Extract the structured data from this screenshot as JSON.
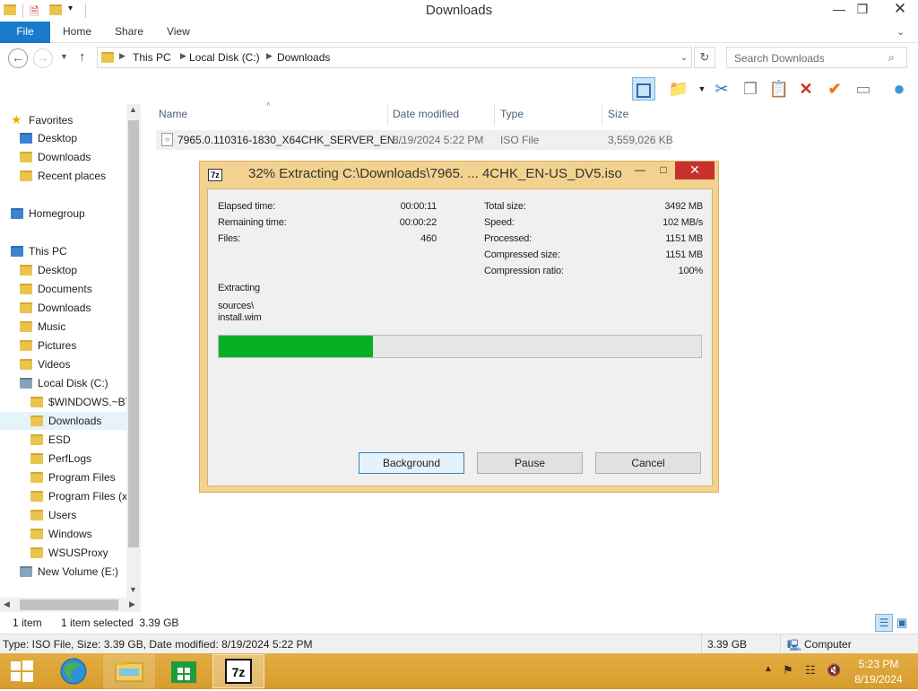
{
  "window": {
    "title": "Downloads",
    "controls": [
      "minimize",
      "restore",
      "close"
    ]
  },
  "ribbon": {
    "tabs": [
      "File",
      "Home",
      "Share",
      "View"
    ]
  },
  "address": {
    "crumbs": [
      "This PC",
      "Local Disk (C:)",
      "Downloads"
    ],
    "search_placeholder": "Search Downloads"
  },
  "nav": {
    "favorites_label": "Favorites",
    "favorites": [
      "Desktop",
      "Downloads",
      "Recent places"
    ],
    "homegroup": "Homegroup",
    "thispc_label": "This PC",
    "thispc": [
      "Desktop",
      "Documents",
      "Downloads",
      "Music",
      "Pictures",
      "Videos",
      "Local Disk (C:)"
    ],
    "localdisk": [
      "$WINDOWS.~BT",
      "Downloads",
      "ESD",
      "PerfLogs",
      "Program Files",
      "Program Files (x",
      "Users",
      "Windows",
      "WSUSProxy"
    ],
    "newvolume": "New Volume (E:)",
    "selected": "Downloads"
  },
  "files": {
    "headers": {
      "name": "Name",
      "date": "Date modified",
      "type": "Type",
      "size": "Size"
    },
    "rows": [
      {
        "name": "7965.0.110316-1830_X64CHK_SERVER_EN...",
        "date": "8/19/2024 5:22 PM",
        "type": "ISO File",
        "size": "3,559,026 KB"
      }
    ]
  },
  "status": {
    "count": "1 item",
    "selected": "1 item selected  3.39 GB",
    "info": "Type: ISO File, Size: 3.39 GB, Date modified: 8/19/2024 5:22 PM",
    "size": "3.39 GB",
    "location": "Computer"
  },
  "dialog": {
    "title": "32% Extracting C:\\Downloads\\7965. ... 4CHK_EN-US_DV5.iso",
    "icon_text": "7z",
    "left_stats": [
      {
        "label": "Elapsed time:",
        "value": "00:00:11"
      },
      {
        "label": "Remaining time:",
        "value": "00:00:22"
      },
      {
        "label": "Files:",
        "value": "460"
      }
    ],
    "right_stats": [
      {
        "label": "Total size:",
        "value": "3492 MB"
      },
      {
        "label": "Speed:",
        "value": "102 MB/s"
      },
      {
        "label": "Processed:",
        "value": "1151 MB"
      },
      {
        "label": "Compressed size:",
        "value": "1151 MB"
      },
      {
        "label": "Compression ratio:",
        "value": "100%"
      }
    ],
    "action": "Extracting",
    "path_line1": "sources\\",
    "path_line2": "install.wim",
    "progress": 0.32,
    "progress_color": "#06b025",
    "buttons": {
      "background": "Background",
      "pause": "Pause",
      "cancel": "Cancel"
    }
  },
  "taskbar": {
    "apps": [
      "start-button",
      "browser",
      "file-explorer",
      "store",
      "7zip"
    ],
    "active": "7zip",
    "time": "5:23 PM",
    "date": "8/19/2024",
    "color": "#dca23a"
  }
}
